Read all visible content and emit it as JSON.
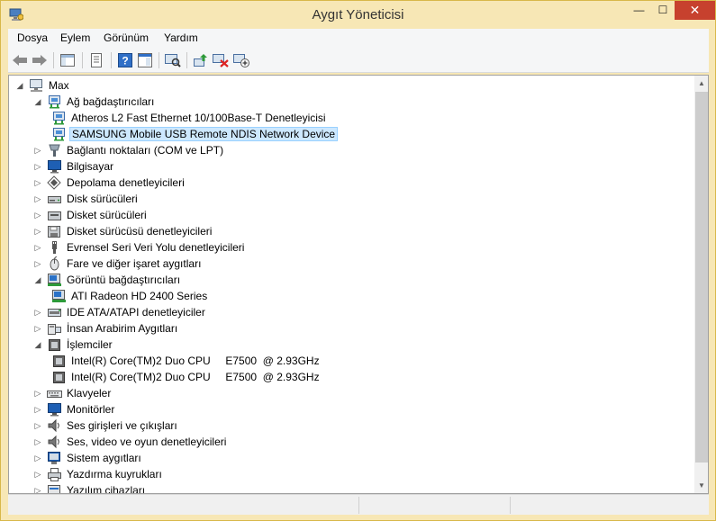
{
  "window": {
    "title": "Aygıt Yöneticisi",
    "minimize": "—",
    "maximize": "☐",
    "close": "✕"
  },
  "menu": [
    "Dosya",
    "Eylem",
    "Görünüm",
    "Yardım"
  ],
  "colors": {
    "title_bg": "#f7e7b5",
    "close_bg": "#c7412e",
    "selection_bg": "#cde8ff",
    "selection_border": "#99d1ff"
  },
  "toolbar": {
    "buttons": [
      "back-icon",
      "forward-icon",
      "show-hide-console-tree-icon",
      "properties-icon",
      "help-icon",
      "action-pane-icon",
      "scan-hardware-icon",
      "update-driver-icon",
      "uninstall-device-icon",
      "add-legacy-hardware-icon"
    ]
  },
  "tree": {
    "root": {
      "label": "Max",
      "icon": "computer-icon",
      "expanded": true
    },
    "nodes": [
      {
        "label": "Ağ bağdaştırıcıları",
        "icon": "network-adapter-icon",
        "level": 1,
        "expanded": true
      },
      {
        "label": "Atheros L2 Fast Ethernet 10/100Base-T Denetleyicisi",
        "icon": "network-adapter-icon",
        "level": 2
      },
      {
        "label": "SAMSUNG Mobile USB Remote NDIS Network Device",
        "icon": "network-adapter-icon",
        "level": 2,
        "selected": true
      },
      {
        "label": "Bağlantı noktaları (COM ve LPT)",
        "icon": "port-icon",
        "level": 1,
        "expanded": false
      },
      {
        "label": "Bilgisayar",
        "icon": "computer-monitor-icon",
        "level": 1,
        "expanded": false
      },
      {
        "label": "Depolama denetleyicileri",
        "icon": "storage-controller-icon",
        "level": 1,
        "expanded": false
      },
      {
        "label": "Disk sürücüleri",
        "icon": "disk-drive-icon",
        "level": 1,
        "expanded": false
      },
      {
        "label": "Disket sürücüleri",
        "icon": "floppy-drive-icon",
        "level": 1,
        "expanded": false
      },
      {
        "label": "Disket sürücüsü denetleyicileri",
        "icon": "floppy-controller-icon",
        "level": 1,
        "expanded": false
      },
      {
        "label": "Evrensel Seri Veri Yolu denetleyicileri",
        "icon": "usb-icon",
        "level": 1,
        "expanded": false
      },
      {
        "label": "Fare ve diğer işaret aygıtları",
        "icon": "mouse-icon",
        "level": 1,
        "expanded": false
      },
      {
        "label": "Görüntü bağdaştırıcıları",
        "icon": "display-adapter-icon",
        "level": 1,
        "expanded": true
      },
      {
        "label": "ATI Radeon HD 2400 Series",
        "icon": "display-adapter-icon",
        "level": 2
      },
      {
        "label": "IDE ATA/ATAPI denetleyiciler",
        "icon": "ide-controller-icon",
        "level": 1,
        "expanded": false
      },
      {
        "label": "İnsan Arabirim Aygıtları",
        "icon": "hid-icon",
        "level": 1,
        "expanded": false
      },
      {
        "label": "İşlemciler",
        "icon": "processor-icon",
        "level": 1,
        "expanded": true
      },
      {
        "label": "Intel(R) Core(TM)2 Duo CPU     E7500  @ 2.93GHz",
        "icon": "processor-icon",
        "level": 2
      },
      {
        "label": "Intel(R) Core(TM)2 Duo CPU     E7500  @ 2.93GHz",
        "icon": "processor-icon",
        "level": 2
      },
      {
        "label": "Klavyeler",
        "icon": "keyboard-icon",
        "level": 1,
        "expanded": false
      },
      {
        "label": "Monitörler",
        "icon": "monitor-icon",
        "level": 1,
        "expanded": false
      },
      {
        "label": "Ses girişleri ve çıkışları",
        "icon": "speaker-icon",
        "level": 1,
        "expanded": false
      },
      {
        "label": "Ses, video ve oyun denetleyicileri",
        "icon": "speaker-icon",
        "level": 1,
        "expanded": false
      },
      {
        "label": "Sistem aygıtları",
        "icon": "system-device-icon",
        "level": 1,
        "expanded": false
      },
      {
        "label": "Yazdırma kuyrukları",
        "icon": "printer-icon",
        "level": 1,
        "expanded": false
      },
      {
        "label": "Yazılım cihazları",
        "icon": "software-device-icon",
        "level": 1,
        "expanded": false
      }
    ]
  }
}
